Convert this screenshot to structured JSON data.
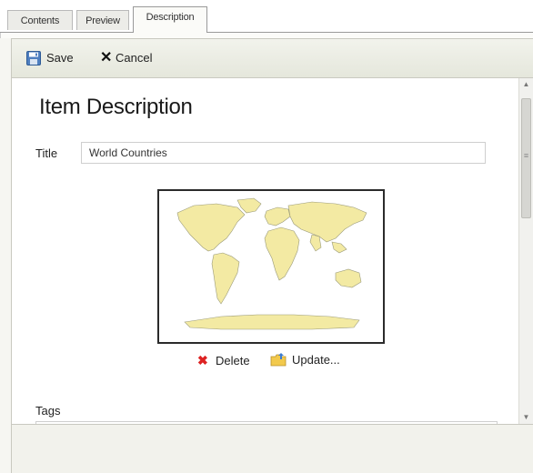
{
  "tabs": [
    {
      "label": "Contents",
      "active": false
    },
    {
      "label": "Preview",
      "active": false
    },
    {
      "label": "Description",
      "active": true
    }
  ],
  "toolbar": {
    "save_label": "Save",
    "cancel_label": "Cancel",
    "save_icon": "floppy-disk-icon",
    "cancel_icon": "close-icon"
  },
  "description": {
    "heading": "Item Description",
    "title_label": "Title",
    "title_value": "World Countries",
    "thumbnail_icon": "world-map-thumbnail",
    "delete_label": "Delete",
    "update_label": "Update...",
    "tags_label": "Tags"
  },
  "colors": {
    "land": "#f3eaa3",
    "land_stroke": "#9a9a7a",
    "delete": "#dd2222",
    "toolbar_bg": "#e9eae1"
  }
}
